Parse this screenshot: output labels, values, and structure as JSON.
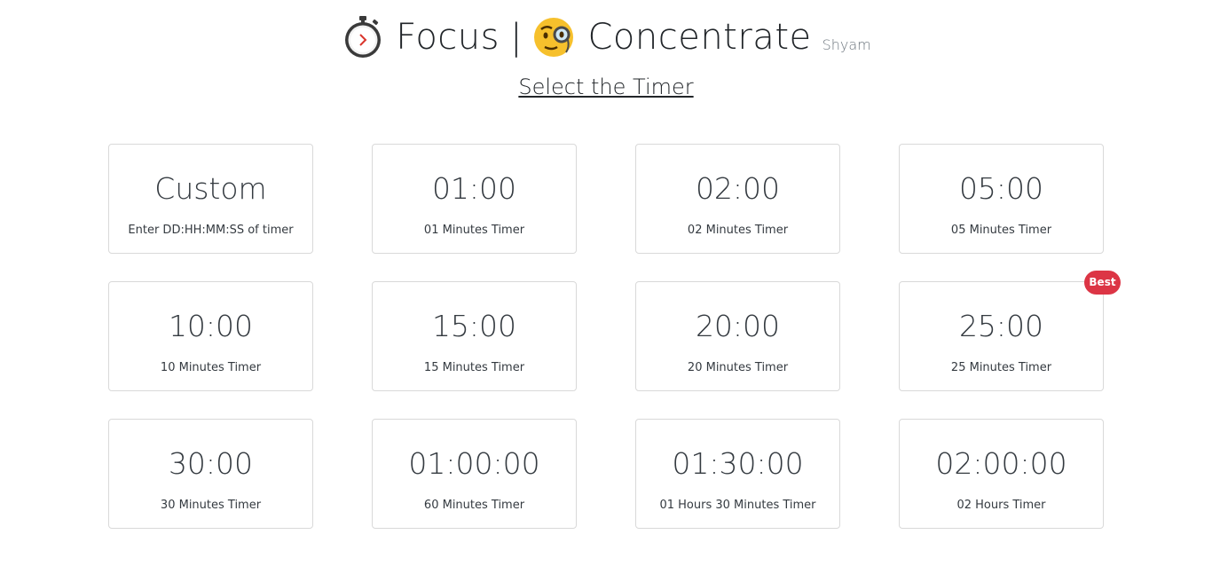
{
  "header": {
    "title_left": "Focus",
    "separator": "|",
    "title_right": "Concentrate",
    "author": "Shyam",
    "icons": [
      "stopwatch-icon",
      "face-with-monocle-icon"
    ]
  },
  "subtitle": "Select the Timer",
  "timers": [
    {
      "time": "Custom",
      "desc": "Enter DD:HH:MM:SS of timer"
    },
    {
      "time": "01:00",
      "desc": "01 Minutes Timer"
    },
    {
      "time": "02:00",
      "desc": "02 Minutes Timer"
    },
    {
      "time": "05:00",
      "desc": "05 Minutes Timer"
    },
    {
      "time": "10:00",
      "desc": "10 Minutes Timer"
    },
    {
      "time": "15:00",
      "desc": "15 Minutes Timer"
    },
    {
      "time": "20:00",
      "desc": "20 Minutes Timer"
    },
    {
      "time": "25:00",
      "desc": "25 Minutes Timer"
    },
    {
      "time": "30:00",
      "desc": "30 Minutes Timer"
    },
    {
      "time": "01:00:00",
      "desc": "60 Minutes Timer"
    },
    {
      "time": "01:30:00",
      "desc": "01 Hours 30 Minutes Timer"
    },
    {
      "time": "02:00:00",
      "desc": "02 Hours Timer"
    }
  ],
  "badge": {
    "label": "Best",
    "color": "#dc3545"
  }
}
